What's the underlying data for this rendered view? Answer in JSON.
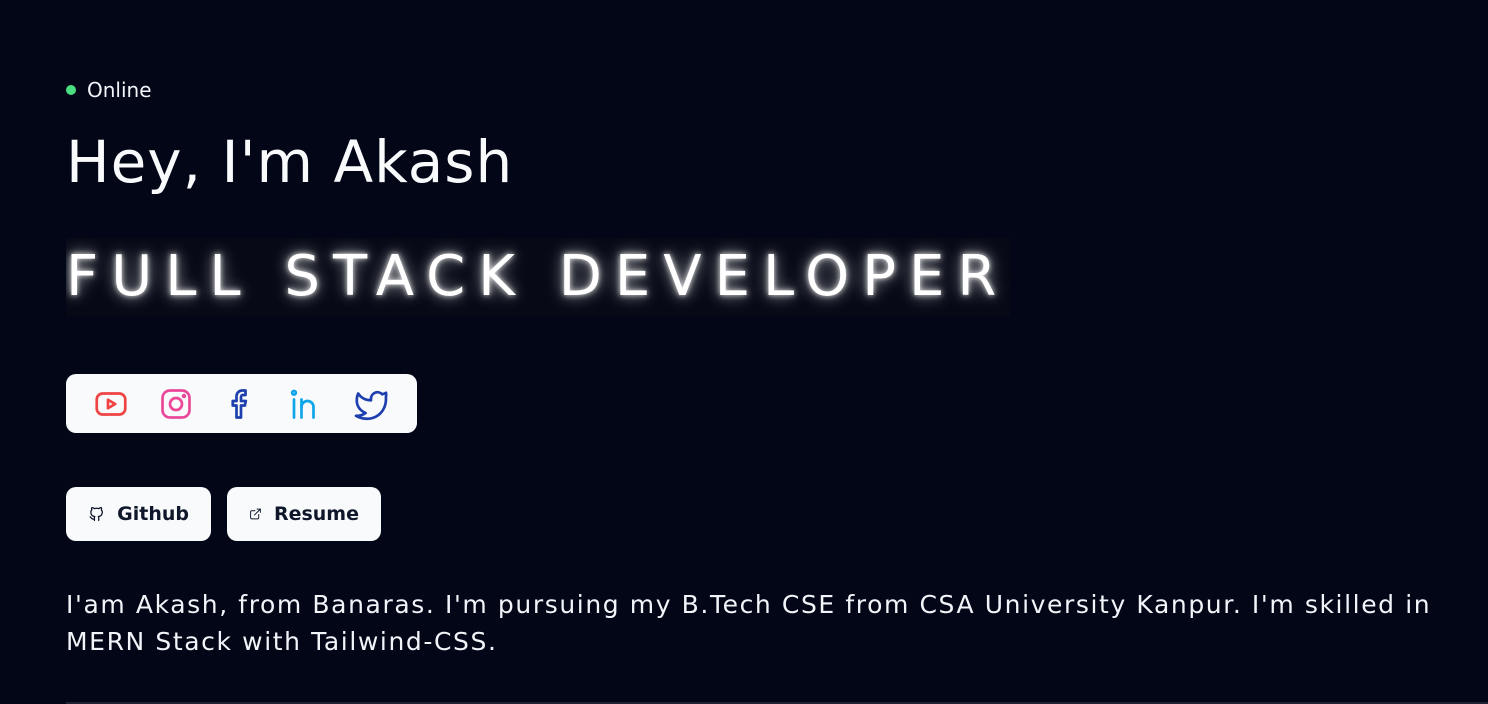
{
  "status": {
    "label": "Online",
    "color": "#4ade80"
  },
  "greeting": "Hey, I'm Akash",
  "role": "FULL STACK DEVELOPER",
  "social": [
    {
      "name": "youtube-icon",
      "color": "#ef4444"
    },
    {
      "name": "instagram-icon",
      "color": "#ec4899"
    },
    {
      "name": "facebook-icon",
      "color": "#1e40af"
    },
    {
      "name": "linkedin-icon",
      "color": "#0ea5e9"
    },
    {
      "name": "twitter-icon",
      "color": "#1e40af"
    }
  ],
  "buttons": {
    "github": {
      "label": "Github",
      "icon": "github-icon"
    },
    "resume": {
      "label": "Resume",
      "icon": "external-link-icon"
    }
  },
  "bio": "I'am Akash, from Banaras. I'm pursuing my B.Tech CSE from CSA University Kanpur. I'm skilled in MERN Stack with Tailwind-CSS."
}
